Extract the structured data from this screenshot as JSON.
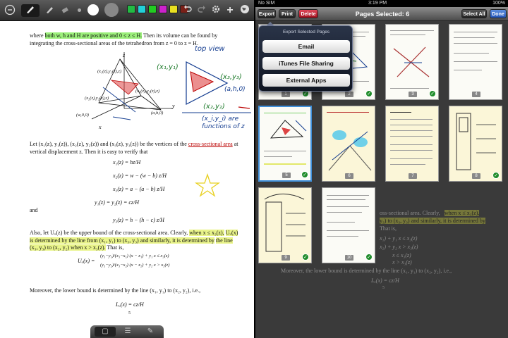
{
  "left_toolbar": {
    "icons": [
      "clear-icon",
      "pen-icon",
      "pencil-icon",
      "eraser-icon",
      "undo-icon",
      "redo-icon",
      "gear-icon",
      "plus-icon",
      "globe-icon"
    ],
    "colors": [
      "#22bb44",
      "#22d0d8",
      "#22cc22",
      "#cc22cc",
      "#e8e020",
      "#7a2018"
    ]
  },
  "document": {
    "line1_pre": "where",
    "line1_hl": "both w, h and H are positive and 0 ≤ z ≤ H.",
    "line1_post": "Then its volume can be found by",
    "line2": "integrating the cross-sectional areas of the tetrahedron from z = 0 to z = H.",
    "ink_top_view": "top view",
    "ink_x1y1": "(x₁,y₁)",
    "ink_x3y3": "(x₃,y₃)",
    "ink_x2y2": "(x₂,y₂)",
    "ink_ah0": "(a,h,0)",
    "ink_note": "(x_i,y_i) are functions of z",
    "fig_labels": [
      "z",
      "(x₁(z),y₁(z),z)",
      "(x₃(z),y₃(z),z)",
      "(x₂(z),y₂(z),z)",
      "(w,0,0)",
      "(a,h,0)",
      "y",
      "x"
    ],
    "para2_a": "Let (x₁(z), y₁(z)), (x₂(z), y₂(z)) and (x₃(z), y₃(z)) be the vertices of the",
    "para2_link": "cross-sectional area",
    "para2_b": "at vertical displacement z. Then it is easy to verify that",
    "eqs": [
      "x₁(z) = hz/H",
      "x₂(z) = w − (w − b) z/H",
      "x₃(z) = a − (a − b) z/H",
      "y₁(z) = y₂(z) = cz/H"
    ],
    "and": "and",
    "eq_y3": "y₃(z) = h − (h − c) z/H",
    "para3_pre": "Also, let Uᵤ(z) be the upper bound of the cross-sectional area. Clearly,",
    "para3_hl1": "when x ≤ x₃(z),",
    "para3_hl2": "Uᵤ(x) is determined by the line from (x₁, y₁) to (x₃, y₃) and similarly, it is determined by",
    "para3_hl3": "the line (x₃, y₃) to (x₂, y₂) when x > x₃(z).",
    "para3_post": "That is,",
    "piecewise_lhs": "Uᵤ(x) =",
    "piecewise_1": "(y₃−y₁)/(x₃−x₁) (x − x₁) + y₁   x ≤ x₃(z)",
    "piecewise_2": "(y₃−y₂)/(x₃−x₂) (x − x₂) + y₂   x > x₃(z)",
    "para4": "Moreover, the lower bound is determined by the line (x₁, y₁) to (x₂, y₂), i.e.,",
    "eq_lower": "Lᵤ(x) = cz/H",
    "page_no": "5"
  },
  "right": {
    "status": {
      "carrier": "No SIM",
      "time": "3:19 PM",
      "battery": "100%"
    },
    "nav": {
      "export": "Export",
      "print": "Print",
      "delete": "Delete",
      "title": "Pages Selected: 6",
      "select_all": "Select All",
      "done": "Done"
    },
    "popover": {
      "title": "Export Selected Pages",
      "options": [
        "Email",
        "iTunes File Sharing",
        "External Apps"
      ]
    },
    "thumbs": [
      {
        "num": "1",
        "checked": true
      },
      {
        "num": "2",
        "checked": true
      },
      {
        "num": "3",
        "checked": true
      },
      {
        "num": "4",
        "checked": false
      },
      {
        "num": "5",
        "checked": true
      },
      {
        "num": "6",
        "checked": false
      },
      {
        "num": "7",
        "checked": false
      },
      {
        "num": "8",
        "checked": true
      },
      {
        "num": "9",
        "checked": true
      },
      {
        "num": "10",
        "checked": true
      }
    ],
    "behind": {
      "line1_a": "oss-sectional area. Clearly,",
      "line1_hl": "when x ≤ x₃(z),",
      "line2_hl": "y₃) to (x₃, y₃) and similarly, it is determined by",
      "line3": "That is,",
      "eq1": "x₁) + y₁    x ≤ x₃(z)",
      "eq2": "x₂) + y₂    x > x₃(z)",
      "eq3": "x ≤ x₃(z)",
      "eq4": "x > x₃(z)",
      "para": "Moreover, the lower bound is determined by the line (x₁, y₁) to (x₂, y₂), i.e.,",
      "eq_lower": "Lᵤ(x) = cz/H",
      "page_no": "5"
    }
  }
}
